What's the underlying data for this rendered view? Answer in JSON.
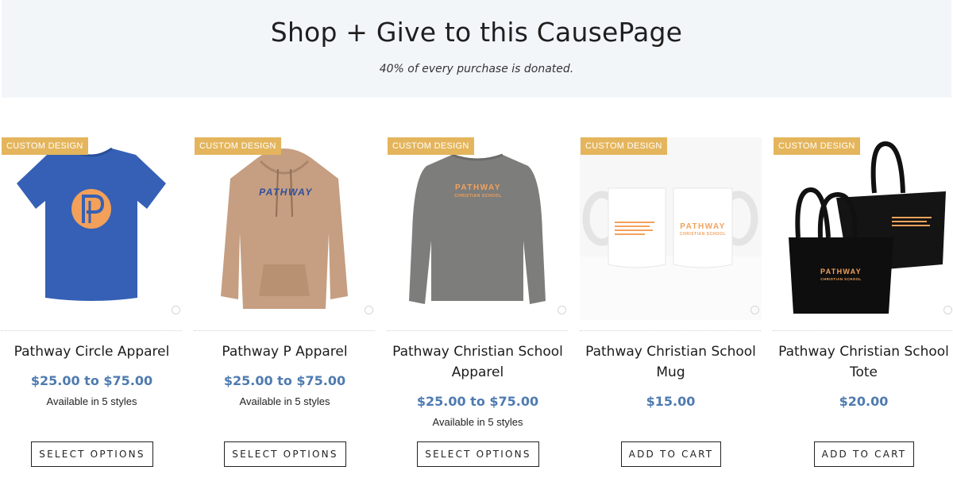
{
  "header": {
    "title": "Shop + Give to this CausePage",
    "subtitle": "40% of every purchase is donated."
  },
  "colors": {
    "accent_badge": "#e4b55c",
    "price": "#4f7bb0",
    "hero_bg": "#f3f6f9"
  },
  "products": [
    {
      "badge": "CUSTOM DESIGN",
      "name": "Pathway Circle Apparel",
      "price": "$25.00 to $75.00",
      "availability": "Available in 5 styles",
      "button": "SELECT OPTIONS",
      "image": "blue-tshirt-with-orange-p-logo"
    },
    {
      "badge": "CUSTOM DESIGN",
      "name": "Pathway P Apparel",
      "price": "$25.00 to $75.00",
      "availability": "Available in 5 styles",
      "button": "SELECT OPTIONS",
      "image": "tan-hoodie-pathway-print",
      "print_text": "PATHWAY"
    },
    {
      "badge": "CUSTOM DESIGN",
      "name": "Pathway Christian School Apparel",
      "price": "$25.00 to $75.00",
      "availability": "Available in 5 styles",
      "button": "SELECT OPTIONS",
      "image": "gray-crewneck-sweatshirt",
      "print_text": "PATHWAY",
      "print_sub": "CHRISTIAN SCHOOL"
    },
    {
      "badge": "CUSTOM DESIGN",
      "name": "Pathway Christian School Mug",
      "price": "$15.00",
      "button": "ADD TO CART",
      "image": "two-white-mugs",
      "print_text": "PATHWAY",
      "print_sub": "CHRISTIAN SCHOOL"
    },
    {
      "badge": "CUSTOM DESIGN",
      "name": "Pathway Christian School Tote",
      "price": "$20.00",
      "button": "ADD TO CART",
      "image": "two-black-tote-bags",
      "print_text": "PATHWAY",
      "print_sub": "CHRISTIAN SCHOOL"
    }
  ]
}
